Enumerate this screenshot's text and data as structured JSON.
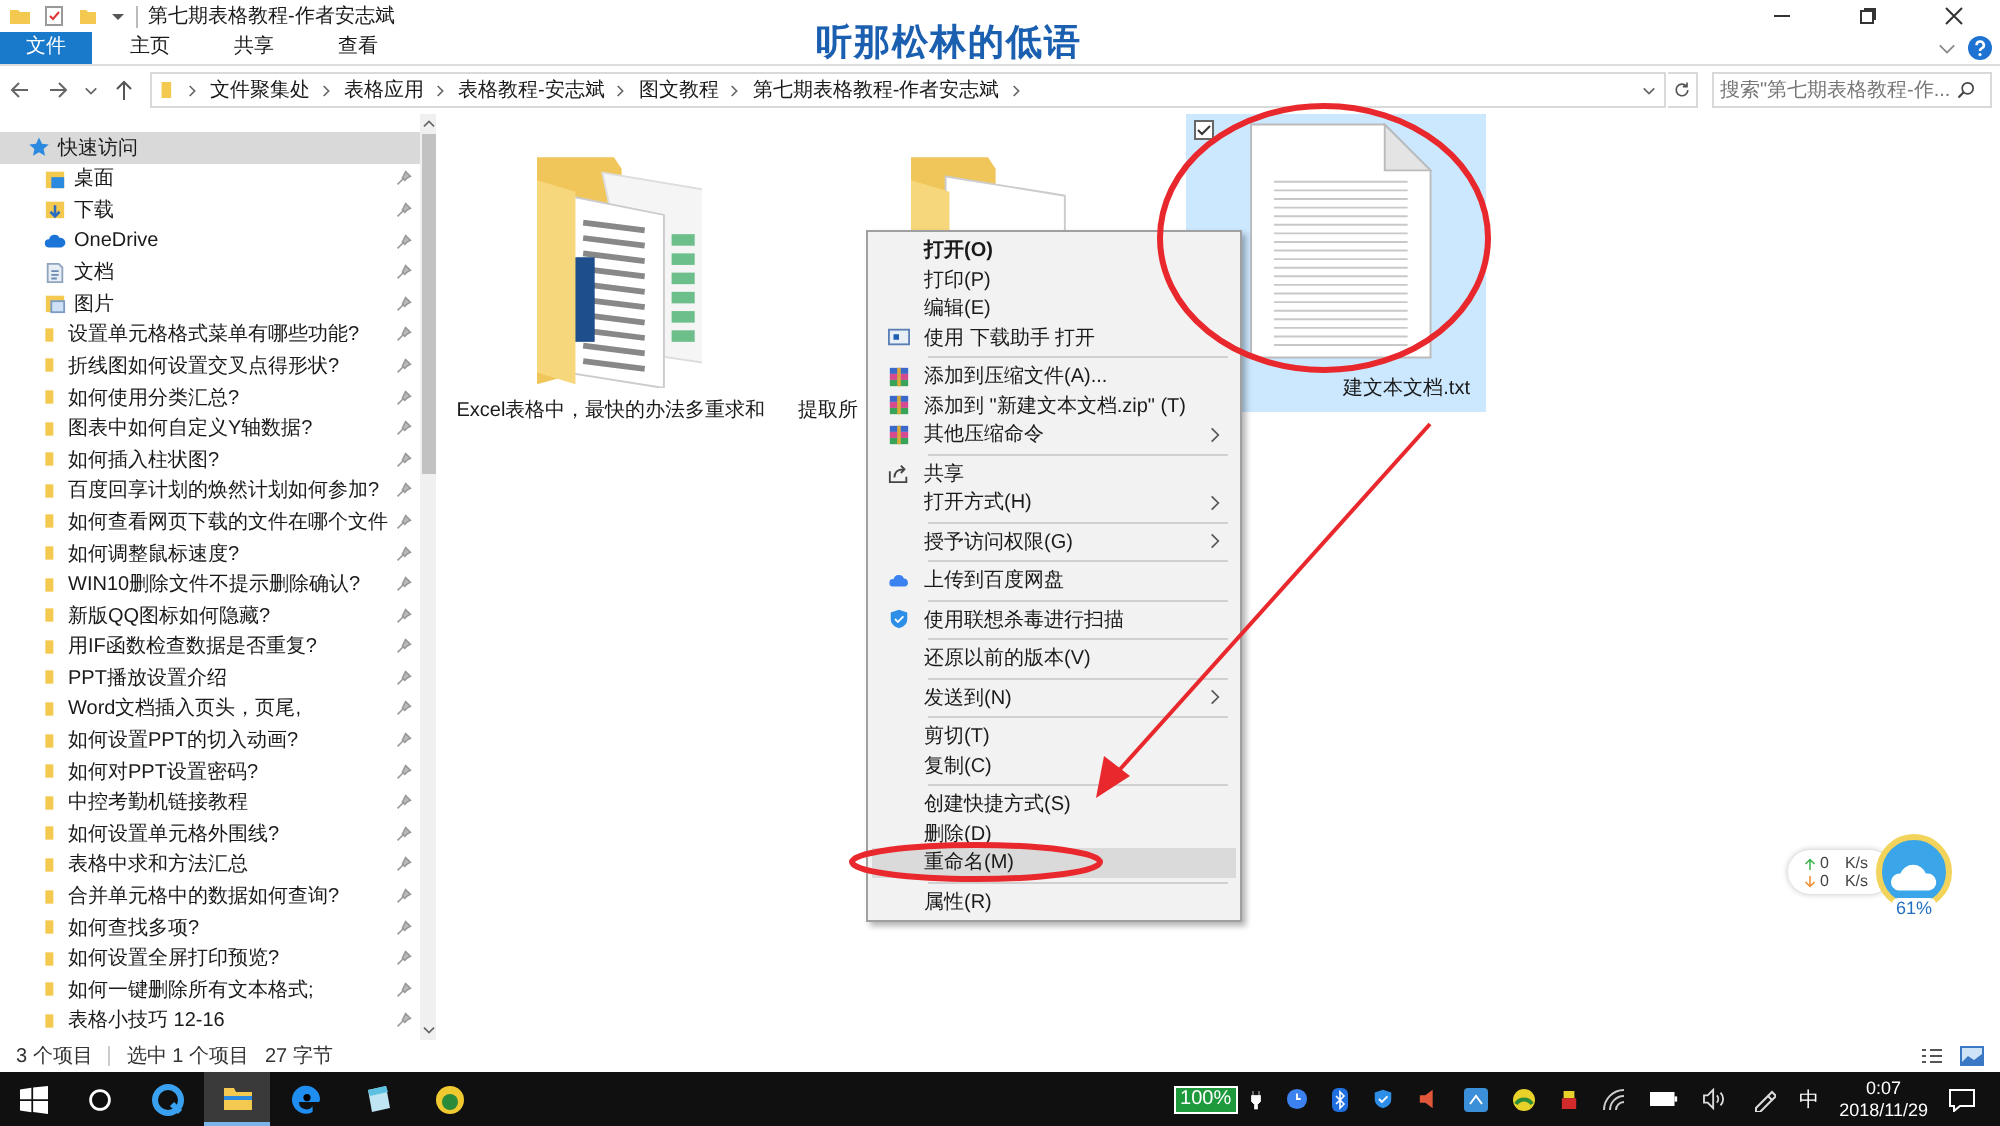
{
  "window": {
    "title": "第七期表格教程-作者安志斌"
  },
  "overlay_caption": "听那松林的低语",
  "ribbon_tabs": [
    {
      "label": "文件",
      "selected": true
    },
    {
      "label": "主页",
      "selected": false
    },
    {
      "label": "共享",
      "selected": false
    },
    {
      "label": "查看",
      "selected": false
    }
  ],
  "address_bar": {
    "path": [
      "文件聚集处",
      "表格应用",
      "表格教程-安志斌",
      "图文教程",
      "第七期表格教程-作者安志斌"
    ]
  },
  "search": {
    "placeholder": "搜索\"第七期表格教程-作..."
  },
  "sidebar": {
    "items": [
      {
        "label": "快速访问",
        "kind": "star",
        "selected": true,
        "children": [
          {
            "label": "桌面",
            "kind": "desktop",
            "pinned": true
          },
          {
            "label": "下载",
            "kind": "downloads",
            "pinned": true
          },
          {
            "label": "OneDrive",
            "kind": "cloud",
            "pinned": true
          },
          {
            "label": "文档",
            "kind": "documents",
            "pinned": true
          },
          {
            "label": "图片",
            "kind": "pictures",
            "pinned": true
          },
          {
            "label": "设置单元格格式菜单有哪些功能?",
            "kind": "folder",
            "pinned": true
          },
          {
            "label": "折线图如何设置交叉点得形状?",
            "kind": "folder",
            "pinned": true
          },
          {
            "label": "如何使用分类汇总?",
            "kind": "folder",
            "pinned": true
          },
          {
            "label": "图表中如何自定义Y轴数据?",
            "kind": "folder",
            "pinned": true
          },
          {
            "label": "如何插入柱状图?",
            "kind": "folder",
            "pinned": true
          },
          {
            "label": "百度回享计划的焕然计划如何参加?",
            "kind": "folder",
            "pinned": true
          },
          {
            "label": "如何查看网页下载的文件在哪个文件",
            "kind": "folder",
            "pinned": true
          },
          {
            "label": "如何调整鼠标速度?",
            "kind": "folder",
            "pinned": true
          },
          {
            "label": "WIN10删除文件不提示删除确认?",
            "kind": "folder",
            "pinned": true
          },
          {
            "label": "新版QQ图标如何隐藏?",
            "kind": "folder",
            "pinned": true
          },
          {
            "label": "用IF函数检查数据是否重复?",
            "kind": "folder",
            "pinned": true
          },
          {
            "label": "PPT播放设置介绍",
            "kind": "folder",
            "pinned": true
          },
          {
            "label": "Word文档插入页头，页尾,",
            "kind": "folder",
            "pinned": true
          },
          {
            "label": "如何设置PPT的切入动画?",
            "kind": "folder",
            "pinned": true
          },
          {
            "label": "如何对PPT设置密码?",
            "kind": "folder",
            "pinned": true
          },
          {
            "label": "中控考勤机链接教程",
            "kind": "folder",
            "pinned": true
          },
          {
            "label": "如何设置单元格外围线?",
            "kind": "folder",
            "pinned": true
          },
          {
            "label": "表格中求和方法汇总",
            "kind": "folder",
            "pinned": true
          },
          {
            "label": "合并单元格中的数据如何查询?",
            "kind": "folder",
            "pinned": true
          },
          {
            "label": "如何查找多项?",
            "kind": "folder",
            "pinned": true
          },
          {
            "label": "如何设置全屏打印预览?",
            "kind": "folder",
            "pinned": true
          },
          {
            "label": "如何一键删除所有文本格式;",
            "kind": "folder",
            "pinned": true
          },
          {
            "label": "表格小技巧 12-16",
            "kind": "folder",
            "pinned": true
          }
        ]
      }
    ]
  },
  "files": [
    {
      "name": "Excel表格中，最快的办法多重求和",
      "kind": "folder_excel",
      "selected": false
    },
    {
      "name": "提取所",
      "kind": "folder_docs",
      "selected": false
    },
    {
      "name": "建文本文档.txt",
      "kind": "text",
      "selected": true
    }
  ],
  "context_menu": {
    "items": [
      {
        "kind": "command",
        "label": "打开(O)",
        "default": true,
        "submenu": false,
        "selected": false
      },
      {
        "kind": "command",
        "label": "打印(P)",
        "default": false,
        "submenu": false,
        "selected": false
      },
      {
        "kind": "command",
        "label": "编辑(E)",
        "default": false,
        "submenu": false,
        "selected": false
      },
      {
        "kind": "app",
        "label": "使用 下载助手 打开",
        "default": false,
        "submenu": false,
        "selected": false
      },
      {
        "kind": "separator"
      },
      {
        "kind": "archive",
        "label": "添加到压缩文件(A)...",
        "default": false,
        "submenu": false,
        "selected": false
      },
      {
        "kind": "archive",
        "label": "添加到 \"新建文本文档.zip\" (T)",
        "default": false,
        "submenu": false,
        "selected": false
      },
      {
        "kind": "archive",
        "label": "其他压缩命令",
        "default": false,
        "submenu": true,
        "selected": false
      },
      {
        "kind": "separator"
      },
      {
        "kind": "share",
        "label": "共享",
        "default": false,
        "submenu": false,
        "selected": false
      },
      {
        "kind": "command",
        "label": "打开方式(H)",
        "default": false,
        "submenu": true,
        "selected": false
      },
      {
        "kind": "separator"
      },
      {
        "kind": "command",
        "label": "授予访问权限(G)",
        "default": false,
        "submenu": true,
        "selected": false
      },
      {
        "kind": "separator"
      },
      {
        "kind": "cloud",
        "label": "上传到百度网盘",
        "default": false,
        "submenu": false,
        "selected": false
      },
      {
        "kind": "separator"
      },
      {
        "kind": "shield",
        "label": "使用联想杀毒进行扫描",
        "default": false,
        "submenu": false,
        "selected": false
      },
      {
        "kind": "separator"
      },
      {
        "kind": "command",
        "label": "还原以前的版本(V)",
        "default": false,
        "submenu": false,
        "selected": false
      },
      {
        "kind": "separator"
      },
      {
        "kind": "command",
        "label": "发送到(N)",
        "default": false,
        "submenu": true,
        "selected": false
      },
      {
        "kind": "separator"
      },
      {
        "kind": "command",
        "label": "剪切(T)",
        "default": false,
        "submenu": false,
        "selected": false
      },
      {
        "kind": "command",
        "label": "复制(C)",
        "default": false,
        "submenu": false,
        "selected": false
      },
      {
        "kind": "separator"
      },
      {
        "kind": "command",
        "label": "创建快捷方式(S)",
        "default": false,
        "submenu": false,
        "selected": false
      },
      {
        "kind": "command",
        "label": "删除(D)",
        "default": false,
        "submenu": false,
        "selected": false
      },
      {
        "kind": "command",
        "label": "重命名(M)",
        "default": false,
        "submenu": false,
        "selected": true
      },
      {
        "kind": "separator"
      },
      {
        "kind": "command",
        "label": "属性(R)",
        "default": false,
        "submenu": false,
        "selected": false
      }
    ]
  },
  "status_bar": {
    "item_count": "3 个项目",
    "selection": "选中 1 个项目",
    "size": "27 字节"
  },
  "net_widget": {
    "up_value": "0",
    "up_unit": "K/s",
    "down_value": "0",
    "down_unit": "K/s",
    "memory": "61%"
  },
  "taskbar": {
    "battery": "100%",
    "ime": "中",
    "time": "0:07",
    "date": "2018/11/29"
  }
}
